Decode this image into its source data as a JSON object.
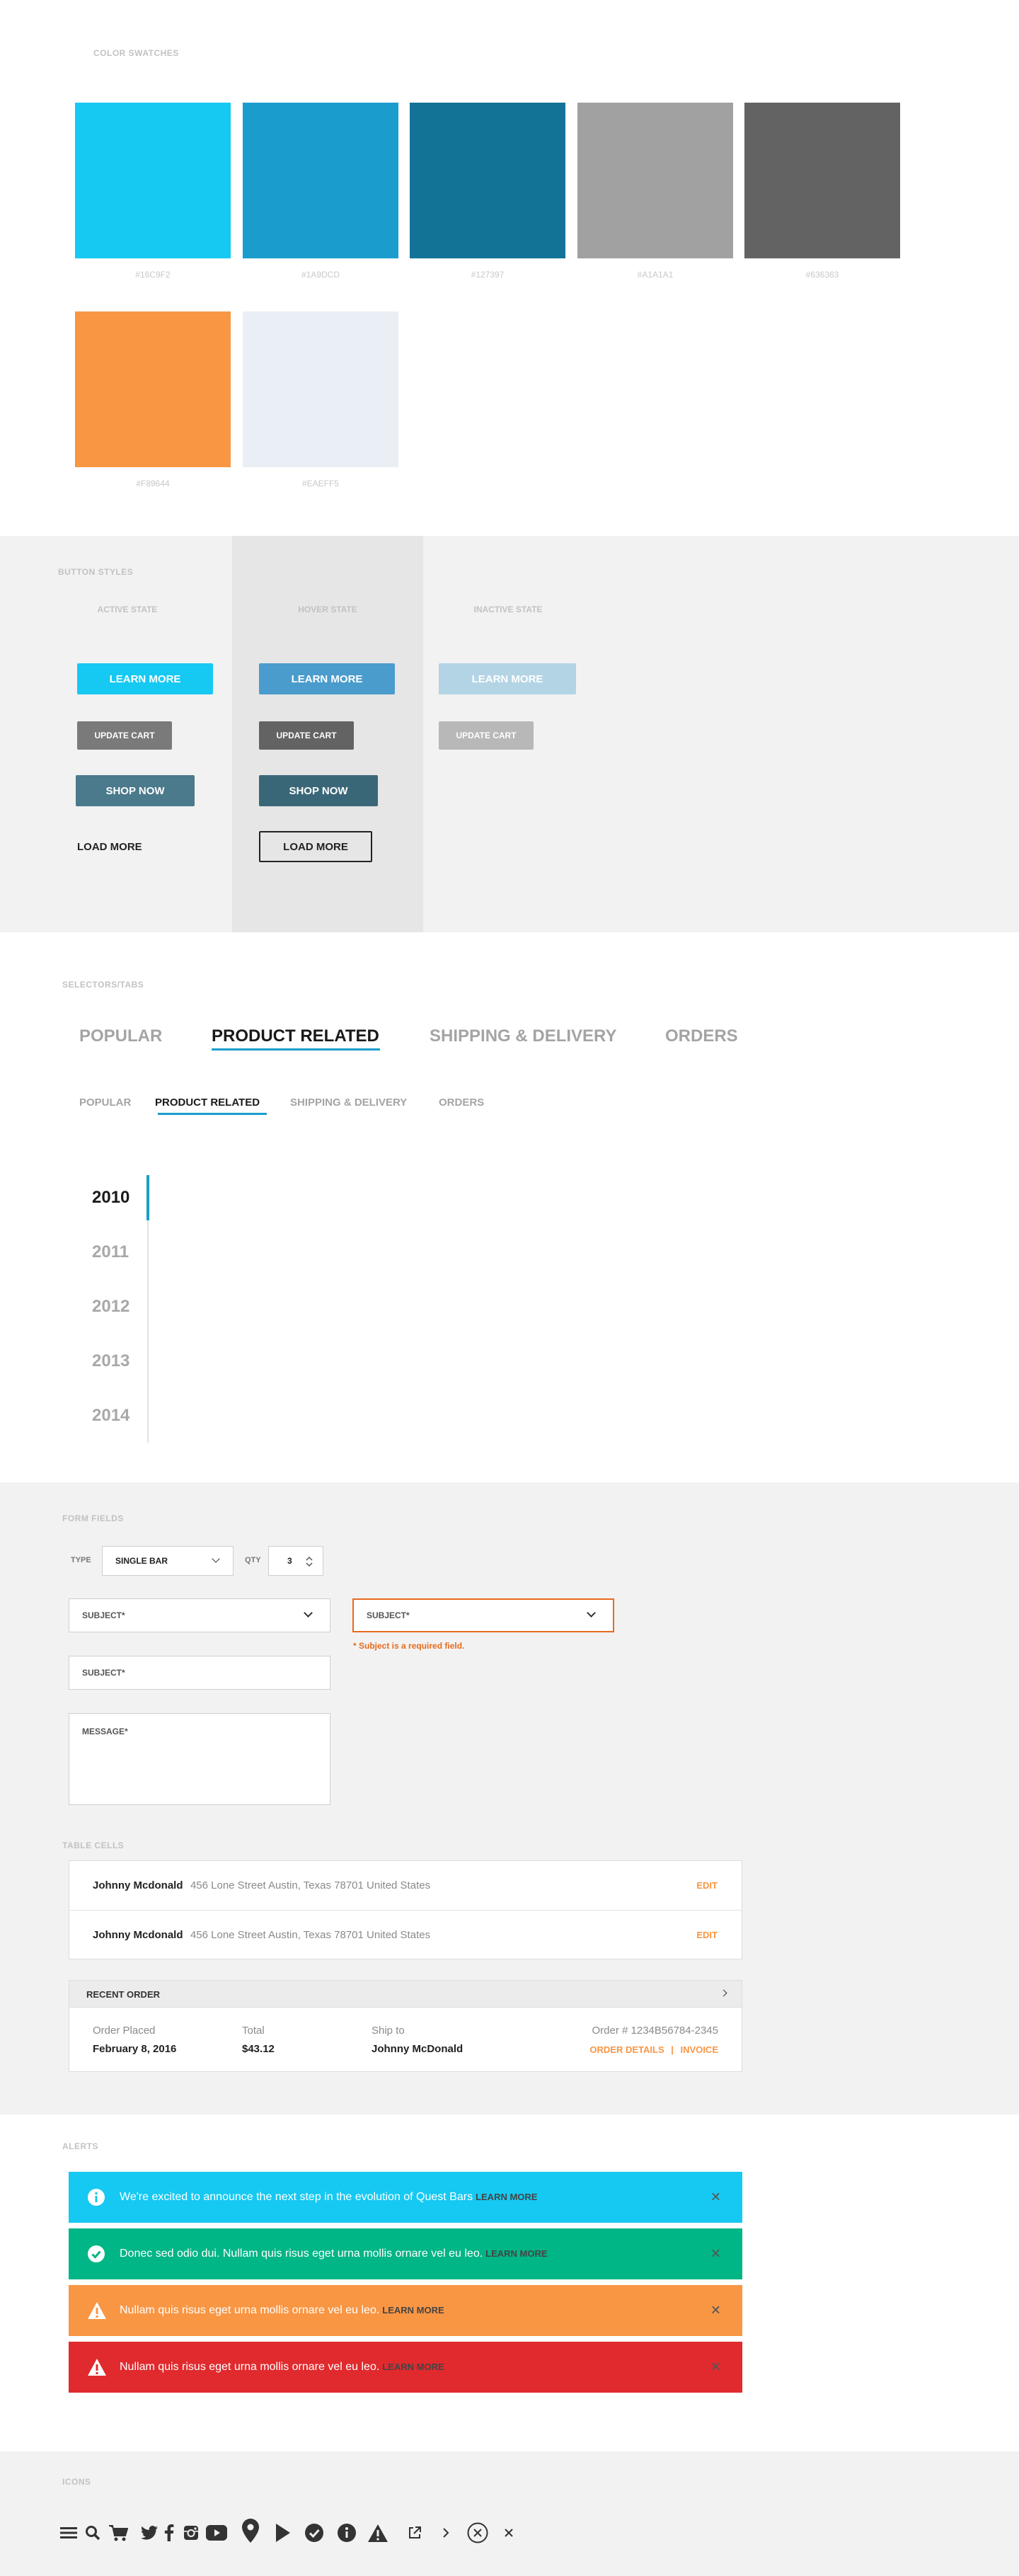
{
  "swatches": {
    "label": "COLOR SWATCHES",
    "items": [
      {
        "hex": "#16C9F2",
        "label": "#16C9F2"
      },
      {
        "hex": "#1A9DCD",
        "label": "#1A9DCD"
      },
      {
        "hex": "#127397",
        "label": "#127397"
      },
      {
        "hex": "#A1A1A1",
        "label": "#A1A1A1"
      },
      {
        "hex": "#636363",
        "label": "#636363"
      },
      {
        "hex": "#F89644",
        "label": "#F89644"
      },
      {
        "hex": "#EAEFF5",
        "label": "#EAEFF5"
      }
    ]
  },
  "buttons": {
    "label": "BUTTON STYLES",
    "active_state": "ACTIVE STATE",
    "hover_state": "HOVER STATE",
    "inactive_state": "INACTIVE STATE",
    "learn_more": "LEARN MORE",
    "update_cart": "UPDATE CART",
    "shop_now": "SHOP NOW",
    "load_more": "LOAD MORE"
  },
  "tabs": {
    "label": "SELECTORS/TABS",
    "large": [
      "POPULAR",
      "PRODUCT RELATED",
      "SHIPPING & DELIVERY",
      "ORDERS"
    ],
    "small": [
      "POPULAR",
      "PRODUCT RELATED",
      "SHIPPING & DELIVERY",
      "ORDERS"
    ],
    "active_index": 1,
    "years": [
      "2010",
      "2011",
      "2012",
      "2013",
      "2014"
    ],
    "active_year": "2010"
  },
  "forms": {
    "label": "FORM FIELDS",
    "type_label": "TYPE",
    "type_value": "SINGLE BAR",
    "qty_label": "QTY",
    "qty_value": "3",
    "subject_placeholder": "SUBJECT*",
    "subject_error_placeholder": "SUBJECT*",
    "subject_error_text": "* Subject is a required field.",
    "subject_text_placeholder": "SUBJECT*",
    "message_placeholder": "MESSAGE*"
  },
  "table": {
    "label": "TABLE CELLS",
    "rows": [
      {
        "name": "Johnny Mcdonald",
        "address": "456 Lone Street  Austin, Texas 78701 United States",
        "action": "EDIT"
      },
      {
        "name": "Johnny Mcdonald",
        "address": "456 Lone Street  Austin, Texas 78701 United States",
        "action": "EDIT"
      }
    ],
    "order": {
      "header": "RECENT ORDER",
      "placed_label": "Order Placed",
      "placed_value": "February 8, 2016",
      "total_label": "Total",
      "total_value": "$43.12",
      "ship_label": "Ship to",
      "ship_value": "Johnny McDonald",
      "order_number": "Order # 1234B56784-2345",
      "details_link": "ORDER DETAILS",
      "separator": "|",
      "invoice_link": "INVOICE"
    }
  },
  "alerts": {
    "label": "ALERTS",
    "items": [
      {
        "type": "info",
        "color": "#16C9F2",
        "text": "We're excited to announce the next step in the evolution of Quest Bars",
        "link": "LEARN MORE"
      },
      {
        "type": "success",
        "color": "#00B586",
        "text": "Donec sed odio dui. Nullam quis risus eget urna mollis ornare vel eu leo.",
        "link": "LEARN MORE"
      },
      {
        "type": "warning",
        "color": "#F89644",
        "text": "Nullam quis risus eget urna mollis ornare vel eu leo.",
        "link": "LEARN MORE"
      },
      {
        "type": "error",
        "color": "#E02A2E",
        "text": "Nullam quis risus eget urna mollis ornare vel eu leo.",
        "link": "LEARN MORE"
      }
    ]
  },
  "icons": {
    "label": "ICONS",
    "items": [
      "menu-icon",
      "search-icon",
      "cart-icon",
      "twitter-icon",
      "facebook-icon",
      "instagram-icon",
      "youtube-icon",
      "map-pin-icon",
      "play-icon",
      "check-circle-icon",
      "info-circle-icon",
      "warning-icon",
      "external-link-icon",
      "chevron-right-icon",
      "close-circle-icon",
      "close-icon"
    ]
  }
}
